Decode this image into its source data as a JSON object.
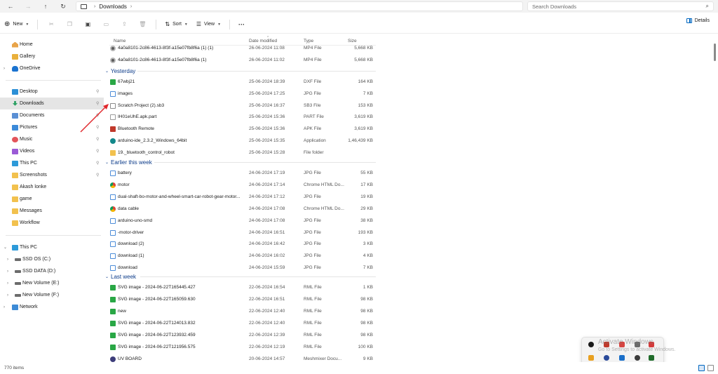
{
  "address": {
    "path": [
      "Downloads"
    ],
    "search_placeholder": "Search Downloads"
  },
  "toolbar": {
    "new_label": "New",
    "sort_label": "Sort",
    "view_label": "View",
    "more_label": "···",
    "details_label": "Details"
  },
  "sidebar": {
    "top": [
      {
        "label": "Home",
        "icon": "home-icon"
      },
      {
        "label": "Gallery",
        "icon": "gallery-icon"
      },
      {
        "label": "OneDrive",
        "icon": "cloud-icon"
      }
    ],
    "pinned": [
      {
        "label": "Desktop",
        "icon": "desktop-icon",
        "pinned": true
      },
      {
        "label": "Downloads",
        "icon": "download-icon",
        "pinned": true,
        "selected": true
      },
      {
        "label": "Documents",
        "icon": "documents-icon",
        "pinned": true
      },
      {
        "label": "Pictures",
        "icon": "pictures-icon",
        "pinned": true
      },
      {
        "label": "Music",
        "icon": "music-icon",
        "pinned": true
      },
      {
        "label": "Videos",
        "icon": "videos-icon",
        "pinned": true
      },
      {
        "label": "This PC",
        "icon": "pc-icon",
        "pinned": true
      },
      {
        "label": "Screenshots",
        "icon": "folder-icon",
        "pinned": true
      },
      {
        "label": "Akash lonke",
        "icon": "folder-icon"
      },
      {
        "label": "game",
        "icon": "folder-icon"
      },
      {
        "label": "Messages",
        "icon": "folder-icon"
      },
      {
        "label": "Workflow",
        "icon": "folder-icon"
      }
    ],
    "tree": [
      {
        "label": "This PC",
        "icon": "pc-icon",
        "expanded": true
      },
      {
        "label": "SSD OS (C:)",
        "icon": "drive-icon"
      },
      {
        "label": "SSD DATA (D:)",
        "icon": "drive-icon"
      },
      {
        "label": "New Volume (E:)",
        "icon": "drive-icon"
      },
      {
        "label": "New Volume (F:)",
        "icon": "drive-icon"
      },
      {
        "label": "Network",
        "icon": "network-icon"
      }
    ]
  },
  "columns": {
    "name": "Name",
    "date": "Date modified",
    "type": "Type",
    "size": "Size"
  },
  "groups": {
    "top_rows": [
      {
        "name": "4a0a8101-2c86-4613-8f3f-a15e07fb8f6a (1) (1)",
        "date": "26-06-2024 11:08",
        "type": "MP4 File",
        "size": "5,668 KB",
        "icon": "video-file-icon"
      },
      {
        "name": "4a0a8101-2c86-4613-8f3f-a15e07fb8f6a (1)",
        "date": "26-06-2024 11:02",
        "type": "MP4 File",
        "size": "5,668 KB",
        "icon": "video-file-icon"
      }
    ],
    "yesterday": {
      "label": "Yesterday",
      "rows": [
        {
          "name": "67wbj21",
          "date": "25-06-2024 18:39",
          "type": "DXF File",
          "size": "164 KB",
          "icon": "dxf-file-icon"
        },
        {
          "name": "images",
          "date": "25-06-2024 17:25",
          "type": "JPG File",
          "size": "7 KB",
          "icon": "jpg-file-icon"
        },
        {
          "name": "Scratch Project (2).sb3",
          "date": "25-06-2024 16:37",
          "type": "SB3 File",
          "size": "153 KB",
          "icon": "generic-file-icon"
        },
        {
          "name": "IH01eUhE.apk.part",
          "date": "25-06-2024 15:36",
          "type": "PART File",
          "size": "3,619 KB",
          "icon": "part-file-icon"
        },
        {
          "name": "Bluetooth Remote",
          "date": "25-06-2024 15:36",
          "type": "APK File",
          "size": "3,619 KB",
          "icon": "apk-file-icon"
        },
        {
          "name": "arduino-ide_2.3.2_Windows_64bit",
          "date": "25-06-2024 15:35",
          "type": "Application",
          "size": "1,46,439 KB",
          "icon": "app-file-icon"
        },
        {
          "name": "19._bluetooth_control_robot",
          "date": "25-06-2024 15:28",
          "type": "File folder",
          "size": "",
          "icon": "folder-file-icon"
        }
      ]
    },
    "earlier": {
      "label": "Earlier this week",
      "rows": [
        {
          "name": "battery",
          "date": "24-06-2024 17:19",
          "type": "JPG File",
          "size": "55 KB",
          "icon": "jpg-file-icon"
        },
        {
          "name": "motor",
          "date": "24-06-2024 17:14",
          "type": "Chrome HTML Do...",
          "size": "17 KB",
          "icon": "chrome-file-icon"
        },
        {
          "name": "dual-shaft-bo-motor-and-wheel-smart-car-robot-gear-motor...",
          "date": "24-06-2024 17:12",
          "type": "JPG File",
          "size": "19 KB",
          "icon": "jpg-file-icon"
        },
        {
          "name": "data cable",
          "date": "24-06-2024 17:08",
          "type": "Chrome HTML Do...",
          "size": "29 KB",
          "icon": "chrome-file-icon"
        },
        {
          "name": "arduino-uno-smd",
          "date": "24-06-2024 17:08",
          "type": "JPG File",
          "size": "38 KB",
          "icon": "jpg-file-icon"
        },
        {
          "name": "-motor-driver",
          "date": "24-06-2024 16:51",
          "type": "JPG File",
          "size": "193 KB",
          "icon": "jpg-file-icon"
        },
        {
          "name": "download (2)",
          "date": "24-06-2024 16:42",
          "type": "JPG File",
          "size": "3 KB",
          "icon": "jpg-file-icon"
        },
        {
          "name": "download (1)",
          "date": "24-06-2024 16:02",
          "type": "JPG File",
          "size": "4 KB",
          "icon": "jpg-file-icon"
        },
        {
          "name": "download",
          "date": "24-06-2024 15:59",
          "type": "JPG File",
          "size": "7 KB",
          "icon": "jpg-file-icon"
        }
      ]
    },
    "lastweek": {
      "label": "Last week",
      "rows": [
        {
          "name": "SVG image - 2024-06-22T165445.427",
          "date": "22-06-2024 16:54",
          "type": "RML File",
          "size": "1 KB",
          "icon": "rml-file-icon"
        },
        {
          "name": "SVG image - 2024-06-22T165059.630",
          "date": "22-06-2024 16:51",
          "type": "RML File",
          "size": "98 KB",
          "icon": "rml-file-icon"
        },
        {
          "name": "new",
          "date": "22-06-2024 12:40",
          "type": "RML File",
          "size": "98 KB",
          "icon": "rml-file-icon"
        },
        {
          "name": "SVG image - 2024-06-22T124013.832",
          "date": "22-06-2024 12:40",
          "type": "RML File",
          "size": "98 KB",
          "icon": "rml-file-icon"
        },
        {
          "name": "SVG image - 2024-06-22T123932.459",
          "date": "22-06-2024 12:39",
          "type": "RML File",
          "size": "98 KB",
          "icon": "rml-file-icon"
        },
        {
          "name": "SVG image - 2024-06-22T121956.575",
          "date": "22-06-2024 12:19",
          "type": "RML File",
          "size": "100 KB",
          "icon": "rml-file-icon"
        },
        {
          "name": "UV BOARD",
          "date": "20-06-2024 14:57",
          "type": "Meshmixer Docu...",
          "size": "9 KB",
          "icon": "meshmixer-file-icon"
        }
      ]
    }
  },
  "status": {
    "item_count": "770 items"
  },
  "watermark": {
    "title": "Activate Windows",
    "subtitle": "Go to Settings to activate Windows."
  },
  "colors": {
    "accent": "#0067c0",
    "group_header": "#0d3c8a",
    "selected_bg": "#e5e5e5",
    "annotation_arrow": "#e0262a"
  }
}
